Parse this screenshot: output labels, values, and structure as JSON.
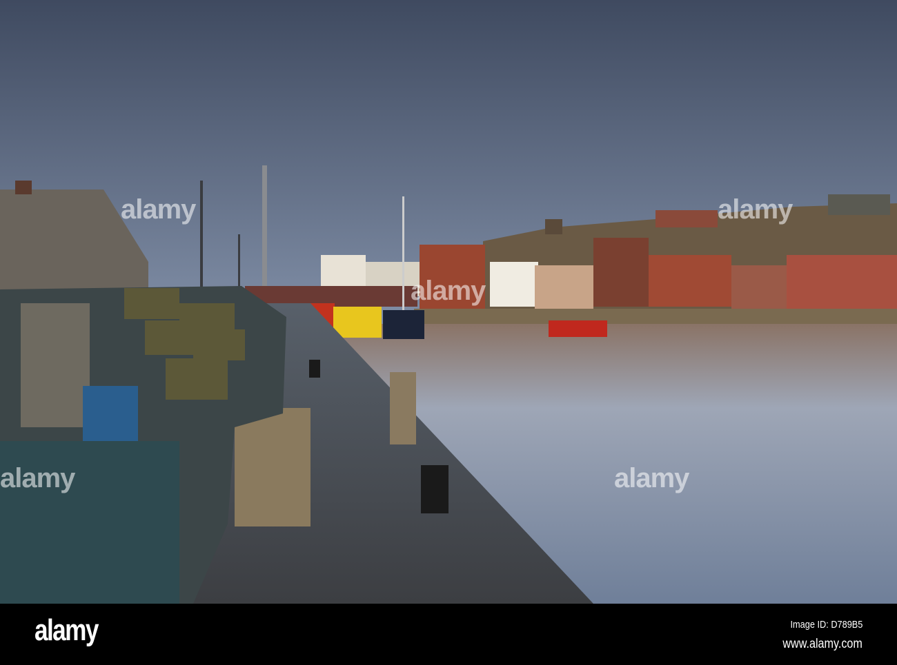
{
  "watermark": {
    "text": "alamy"
  },
  "footer": {
    "logo": "alamy",
    "image_id": "Image ID: D789B5",
    "website": "www.alamy.com"
  }
}
